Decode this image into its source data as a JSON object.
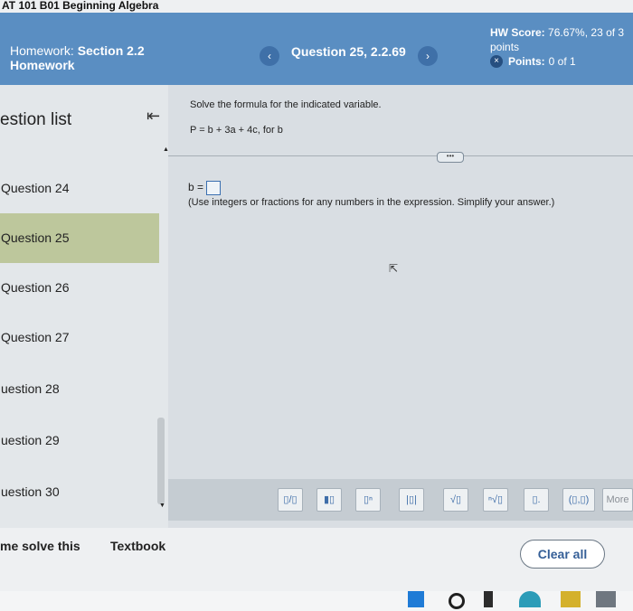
{
  "course_title": "AT 101 B01 Beginning Algebra",
  "header": {
    "hw_label": "Homework:",
    "hw_section": "Section 2.2",
    "hw_subtitle": "Homework",
    "prev_icon": "chevron-left-icon",
    "next_icon": "chevron-right-icon",
    "question_label": "Question 25, 2.2.69",
    "score_label": "HW Score:",
    "score_value": "76.67%, 23 of 3",
    "score_units": "points",
    "points_label": "Points:",
    "points_value": "0 of 1"
  },
  "sidebar": {
    "title": "estion list",
    "items": [
      {
        "label": "Question 24"
      },
      {
        "label": "Question 25",
        "active": true
      },
      {
        "label": "Question 26"
      },
      {
        "label": "Question 27"
      },
      {
        "label": "uestion 28"
      },
      {
        "label": "uestion 29"
      },
      {
        "label": "uestion 30"
      }
    ]
  },
  "problem": {
    "prompt": "Solve the formula for the indicated variable.",
    "formula": "P = b + 3a + 4c, for b",
    "answer_prefix": "b =",
    "instruction": "(Use integers or fractions for any numbers in the expression. Simplify your answer.)",
    "more_dots": "•••"
  },
  "toolbar": {
    "buttons": [
      {
        "icon": "fraction-icon",
        "glyph": "▯/▯"
      },
      {
        "icon": "mixed-number-icon",
        "glyph": "▮▯"
      },
      {
        "icon": "exponent-icon",
        "glyph": "▯ⁿ"
      },
      {
        "icon": "absolute-value-icon",
        "glyph": "|▯|"
      },
      {
        "icon": "square-root-icon",
        "glyph": "√▯"
      },
      {
        "icon": "nth-root-icon",
        "glyph": "ⁿ√▯"
      },
      {
        "icon": "decimal-icon",
        "glyph": "▯."
      },
      {
        "icon": "ordered-pair-icon",
        "glyph": "(▯,▯)"
      }
    ],
    "more_label": "More"
  },
  "footer": {
    "help_label": "me solve this",
    "textbook_label": "Textbook",
    "clear_label": "Clear all"
  },
  "colors": {
    "header_blue": "#5a8ec2",
    "active_item": "#bdc79c",
    "accent": "#355f97"
  }
}
